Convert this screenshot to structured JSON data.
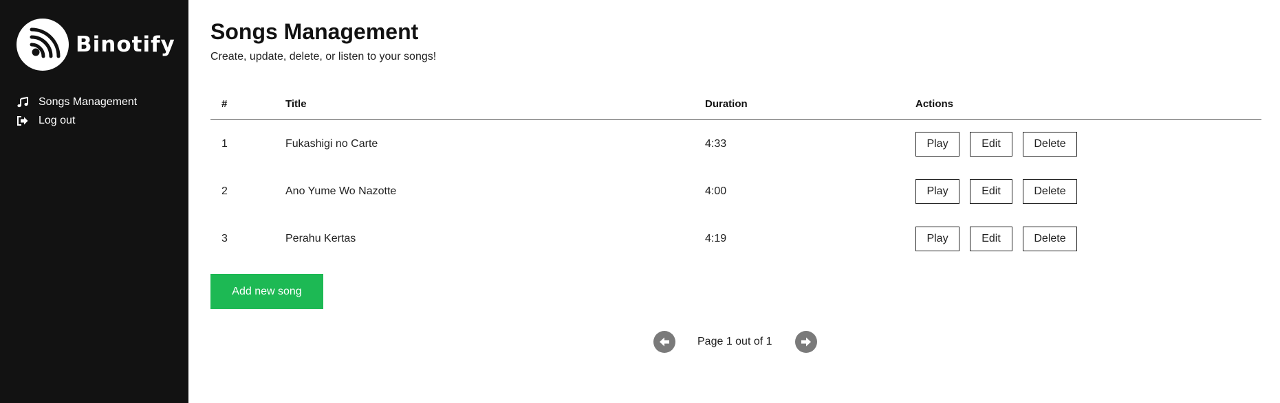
{
  "sidebar": {
    "brand": "Binotify",
    "logo_icon": "rss-signal-icon",
    "items": [
      {
        "label": "Songs Management",
        "icon": "music-note-icon"
      },
      {
        "label": "Log out",
        "icon": "logout-icon"
      }
    ]
  },
  "header": {
    "title": "Songs Management",
    "subtitle": "Create, update, delete, or listen to your songs!"
  },
  "table": {
    "columns": [
      "#",
      "Title",
      "Duration",
      "Actions"
    ],
    "rows": [
      {
        "num": "1",
        "title": "Fukashigi no Carte",
        "duration": "4:33"
      },
      {
        "num": "2",
        "title": "Ano Yume Wo Nazotte",
        "duration": "4:00"
      },
      {
        "num": "3",
        "title": "Perahu Kertas",
        "duration": "4:19"
      }
    ],
    "actions": {
      "play": "Play",
      "edit": "Edit",
      "delete": "Delete"
    }
  },
  "add_button": "Add new song",
  "pagination": {
    "text": "Page 1 out of 1",
    "prev_icon": "arrow-left-circle-icon",
    "next_icon": "arrow-right-circle-icon"
  },
  "colors": {
    "sidebar_bg": "#121212",
    "accent": "#1db954",
    "pager_arrow": "#7a7a7a"
  }
}
